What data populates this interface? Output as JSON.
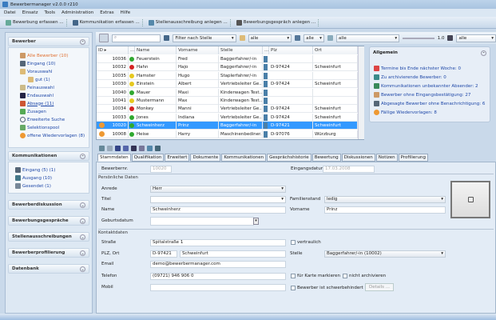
{
  "window": {
    "title": "Bewerbermanager v2.0.0 r210"
  },
  "menu": [
    "Datei",
    "Einsatz",
    "Tools",
    "Administration",
    "Extras",
    "Hilfe"
  ],
  "quickbar": [
    "Bewerbung erfassen ...",
    "Kommunikation erfassen ...",
    "Stellenausschreibung anlegen ...",
    "Bewerbungsgespräch anlegen ..."
  ],
  "sidebar": {
    "bewerber": {
      "title": "Bewerber",
      "items": [
        "Alle Bewerber (10)",
        "Eingang (10)",
        "Vorauswahl",
        "gut (1)",
        "Feinauswahl",
        "Endauswahl",
        "Absage (11)",
        "Zusagen",
        "Erweiterte Suche",
        "Selektionspool",
        "offene Wiedervorlagen (8)"
      ]
    },
    "kommunikation": {
      "title": "Kommunikationen",
      "items": [
        "Eingang (5) (1)",
        "Ausgang (10)",
        "Gesendet (1)"
      ]
    },
    "sections": [
      "Bewerberdiskussion",
      "Bewerbungsgespräche",
      "Stellenausschreibungen",
      "Bewerberprofilierung",
      "Datenbank"
    ]
  },
  "filter": {
    "search_placeholder": "",
    "stelle": "Filter nach Stelle",
    "status": "alle",
    "f2": "alle",
    "f3": "alle",
    "zoom": "1.0",
    "f4": "alle"
  },
  "table": {
    "columns": [
      "ID",
      "...",
      "Name",
      "Vorname",
      "Stelle",
      "...",
      "Plz",
      "Ort"
    ],
    "rows": [
      {
        "id": "10036",
        "status": "green",
        "name": "Feuerstein",
        "vorname": "Fred",
        "stelle": "Baggerfahrer/-in",
        "plz": "",
        "ort": ""
      },
      {
        "id": "10032",
        "status": "red",
        "name": "Hahn",
        "vorname": "Hajo",
        "stelle": "Baggerfahrer/-in",
        "plz": "D-97424",
        "ort": "Schweinfurt"
      },
      {
        "id": "10035",
        "status": "yellow",
        "name": "Hamster",
        "vorname": "Hugo",
        "stelle": "Staplerfahrer/-in",
        "plz": "",
        "ort": ""
      },
      {
        "id": "10030",
        "status": "yellow",
        "name": "Einstein",
        "vorname": "Albert",
        "stelle": "Vertriebsleiter Ge...",
        "plz": "D-97424",
        "ort": "Schweinfurt"
      },
      {
        "id": "10040",
        "status": "green",
        "name": "Mauer",
        "vorname": "Maxi",
        "stelle": "Kinderwagen Test...",
        "plz": "",
        "ort": ""
      },
      {
        "id": "10041",
        "status": "yellow",
        "name": "Mustermann",
        "vorname": "Max",
        "stelle": "Kinderwagen Test...",
        "plz": "",
        "ort": ""
      },
      {
        "id": "10034",
        "status": "red",
        "name": "Monkey",
        "vorname": "Manni",
        "stelle": "Vertriebsleiter Ge...",
        "plz": "D-97424",
        "ort": "Schweinfurt"
      },
      {
        "id": "10033",
        "status": "green",
        "name": "Jones",
        "vorname": "Indiana",
        "stelle": "Vertriebsleiter Ge...",
        "plz": "D-97424",
        "ort": "Schweinfurt"
      },
      {
        "id": "10020",
        "status": "green",
        "name": "Schweinherz",
        "vorname": "Prinz",
        "stelle": "Baggerfahrer/-in",
        "plz": "D-97421",
        "ort": "Schweinfurt",
        "selected": true
      },
      {
        "id": "10008",
        "status": "green",
        "name": "Heise",
        "vorname": "Harry",
        "stelle": "Maschinenbediner...",
        "plz": "D-97076",
        "ort": "Würzburg"
      }
    ]
  },
  "allgemein": {
    "title": "Allgemein",
    "items": [
      "Termine bis Ende nächster Woche: 0",
      "Zu archivierende Bewerber: 0",
      "Kommunikationen unbekannter Absender: 2",
      "Bewerber ohne Eingangsbestätigung: 27",
      "Abgesagte Bewerber ohne Benachrichtigung: 6",
      "Fällige Wiedervorlagen: 8"
    ]
  },
  "tabs": [
    "Stammdaten",
    "Qualifikation",
    "Erweitert",
    "Dokumente",
    "Kommunikationen",
    "Gesprächshistorie",
    "Bewertung",
    "Diskussionen",
    "Notizen",
    "Profilierung"
  ],
  "form": {
    "bewerbernr_label": "Bewerbernr.",
    "bewerbernr": "10020",
    "eingangsdatum_label": "Eingangsdatum",
    "eingangsdatum": "17.03.2008",
    "persoenlich": "Persönliche Daten",
    "anrede_label": "Anrede",
    "anrede": "Herr",
    "titel_label": "Titel",
    "titel": "",
    "familienstand_label": "Familienstand",
    "familienstand": "ledig",
    "name_label": "Name",
    "name": "Schweinherz",
    "vorname_label": "Vorname",
    "vorname": "Prinz",
    "geburtsdatum_label": "Geburtsdatum",
    "geburtsdatum": "",
    "kontakt": "Kontaktdaten",
    "strasse_label": "Straße",
    "strasse": "Spitalstraße 1",
    "vertrauen_label": "vertraulich",
    "plzort_label": "PLZ, Ort",
    "plz": "D-97421",
    "ort": "Schweinfurt",
    "stelle_label": "Stelle",
    "stelle": "Baggerfahrer/-in (10002)",
    "email_label": "Email",
    "email": "demo@bewerbermanager.com",
    "telefon_label": "Telefon",
    "telefon": "(09721) 946 906 0",
    "karte_label": "für Karte markieren",
    "archiv_label": "nicht archivieren",
    "mobil_label": "Mobil",
    "mobil": "",
    "behindert_label": "Bewerber ist schwerbehindert",
    "details_label": "Details ..."
  },
  "colors": {
    "green": "#2fa82f",
    "red": "#d42222",
    "yellow": "#e6c81e",
    "link": "#1f48a8",
    "selected": "#3399ff"
  }
}
